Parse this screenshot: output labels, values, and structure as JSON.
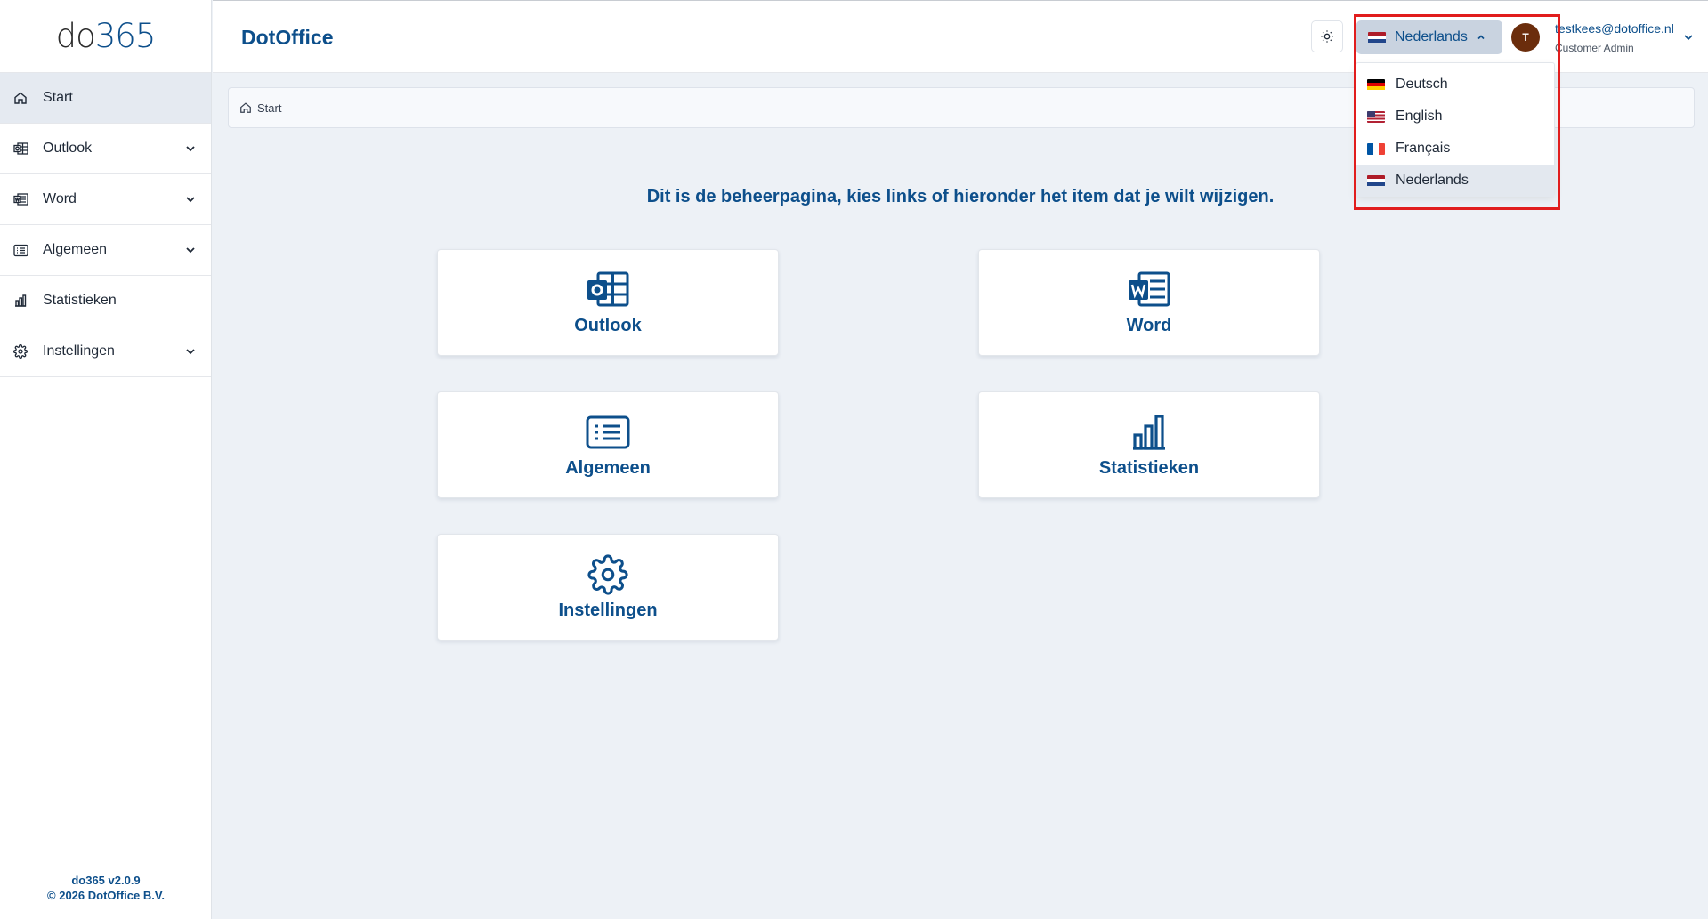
{
  "app": {
    "logo_do": "do",
    "logo_365": "365",
    "brand": "DotOffice",
    "version": "do365 v2.0.9",
    "copyright": "© 2026 DotOffice B.V."
  },
  "sidebar": {
    "items": [
      {
        "label": "Start",
        "icon": "home-icon",
        "expandable": false,
        "active": true
      },
      {
        "label": "Outlook",
        "icon": "outlook-icon",
        "expandable": true
      },
      {
        "label": "Word",
        "icon": "word-icon",
        "expandable": true
      },
      {
        "label": "Algemeen",
        "icon": "list-icon",
        "expandable": true
      },
      {
        "label": "Statistieken",
        "icon": "bar-chart-icon",
        "expandable": false
      },
      {
        "label": "Instellingen",
        "icon": "gear-icon",
        "expandable": true
      }
    ]
  },
  "header": {
    "language_selected": "Nederlands",
    "avatar_initial": "T",
    "user_email": "testkees@dotoffice.nl",
    "user_role": "Customer Admin"
  },
  "language_menu": {
    "options": [
      {
        "label": "Deutsch",
        "flag": "de"
      },
      {
        "label": "English",
        "flag": "us"
      },
      {
        "label": "Français",
        "flag": "fr"
      },
      {
        "label": "Nederlands",
        "flag": "nl",
        "selected": true
      }
    ]
  },
  "breadcrumb": {
    "current": "Start"
  },
  "main": {
    "welcome": "Dit is de beheerpagina, kies links of hieronder het item dat je wilt wijzigen.",
    "tiles": [
      {
        "label": "Outlook",
        "icon": "outlook-icon"
      },
      {
        "label": "Word",
        "icon": "word-icon"
      },
      {
        "label": "Algemeen",
        "icon": "list-icon"
      },
      {
        "label": "Statistieken",
        "icon": "bar-chart-icon"
      },
      {
        "label": "Instellingen",
        "icon": "gear-icon"
      }
    ]
  },
  "colors": {
    "brand_blue": "#0d4f8b",
    "highlight_red": "#e11d1d",
    "avatar_bg": "#6b2d0c"
  }
}
